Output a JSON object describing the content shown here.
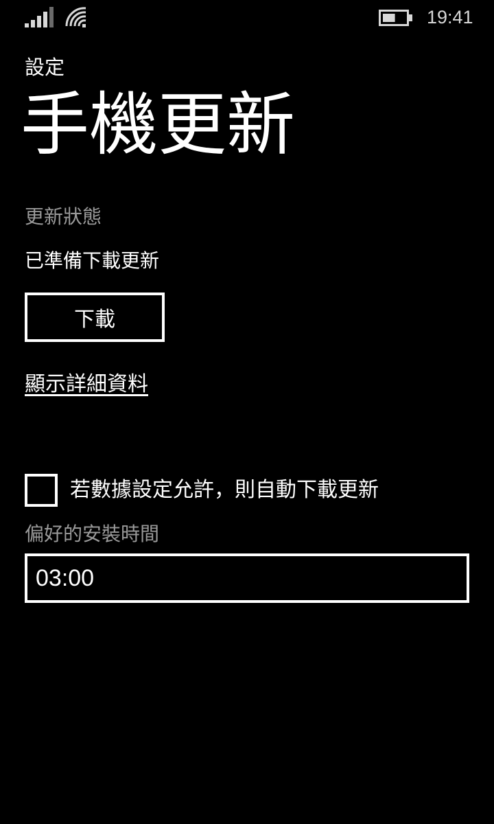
{
  "status_bar": {
    "time": "19:41",
    "signal_icon": "signal-strength-icon",
    "wifi_icon": "wifi-icon",
    "battery_icon": "battery-icon",
    "battery_level": 0.55
  },
  "header": {
    "app_title": "設定",
    "page_title": "手機更新"
  },
  "update_status": {
    "label": "更新狀態",
    "value": "已準備下載更新",
    "download_button_label": "下載",
    "details_link_label": "顯示詳細資料"
  },
  "auto_download": {
    "checked": false,
    "label": "若數據設定允許，則自動下載更新"
  },
  "install_time": {
    "label": "偏好的安裝時間",
    "value": "03:00"
  },
  "colors": {
    "background": "#000000",
    "foreground": "#ffffff",
    "secondary_text": "#9a9a9a"
  }
}
